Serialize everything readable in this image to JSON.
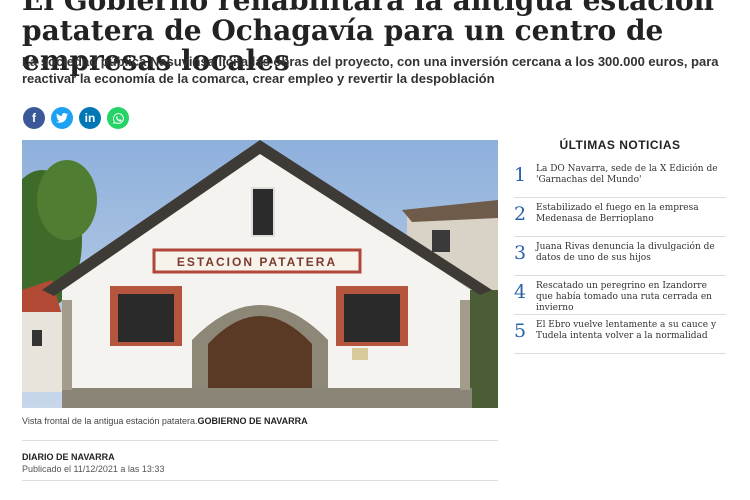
{
  "article": {
    "headline": "El Gobierno rehabilitará la antigua estación patatera de Ochagavía para un centro de empresas locales",
    "subtitle": "La sociedad pública Nasuvinsa licita las obras del proyecto, con una inversión cercana a los 300.000 euros, para reactivar la economía de la comarca, crear empleo y revertir la despoblación",
    "photo_sign": "ESTACION PATATERA",
    "caption": "Vista frontal de la antigua estación patatera.",
    "caption_credit": "GOBIERNO DE NAVARRA",
    "byline": "DIARIO DE NAVARRA",
    "published": "Publicado el 11/12/2021 a las 13:33"
  },
  "share": {
    "facebook": "f",
    "twitter": "t",
    "linkedin": "in",
    "whatsapp": "w",
    "colors": {
      "facebook": "#3b5998",
      "twitter": "#1da1f2",
      "linkedin": "#0077b5",
      "whatsapp": "#25d366"
    }
  },
  "sidebar": {
    "title": "ÚLTIMAS NOTICIAS",
    "accent": "#2b62a8",
    "items": [
      {
        "num": "1",
        "text": "La DO Navarra, sede de la X Edición de 'Garnachas del Mundo'"
      },
      {
        "num": "2",
        "text": "Estabilizado el fuego en la empresa Medenasa de Berrioplano"
      },
      {
        "num": "3",
        "text": "Juana Rivas denuncia la divulgación de datos de uno de sus hijos"
      },
      {
        "num": "4",
        "text": "Rescatado un peregrino en Izandorre que había tomado una ruta cerrada en invierno"
      },
      {
        "num": "5",
        "text": "El Ebro vuelve lentamente a su cauce y Tudela intenta volver a la normalidad"
      }
    ]
  }
}
